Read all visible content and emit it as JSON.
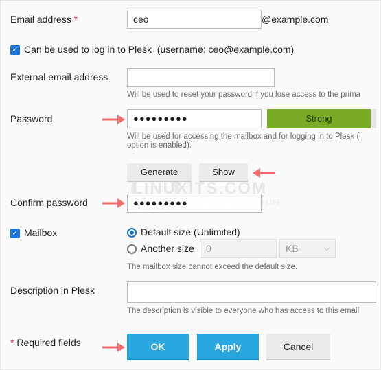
{
  "email": {
    "label": "Email address",
    "required_mark": "*",
    "value": "ceo",
    "domain": "@example.com"
  },
  "login": {
    "label": "Can be used to log in to Plesk",
    "username": "(username: ceo@example.com)",
    "checked": true
  },
  "external": {
    "label": "External email address",
    "value": "",
    "hint": "Will be used to reset your password if you lose access to the prima"
  },
  "password": {
    "label": "Password",
    "value": "●●●●●●●●●",
    "strength": "Strong",
    "strength_color": "#7aab27",
    "hint1": "Will be used for accessing the mailbox and for logging in to Plesk (i",
    "hint2": "option is enabled).",
    "generate": "Generate",
    "show": "Show"
  },
  "confirm": {
    "label": "Confirm password",
    "value": "●●●●●●●●●"
  },
  "mailbox": {
    "label": "Mailbox",
    "checked": true,
    "default_size": "Default size (Unlimited)",
    "another_size": "Another size",
    "size_value": "0",
    "unit": "KB",
    "hint": "The mailbox size cannot exceed the default size."
  },
  "description": {
    "label": "Description in Plesk",
    "value": "",
    "hint": "The description is visible to everyone who has access to this email"
  },
  "footer": {
    "required_mark": "*",
    "required_text": "Required fields",
    "ok": "OK",
    "apply": "Apply",
    "cancel": "Cancel"
  },
  "watermark": {
    "brand": "LINUXITS.COM",
    "tagline": "MAKE EASY YOUR SYSADMIN LIFE"
  },
  "colors": {
    "primary": "#28a8de",
    "arrow": "#f26b6b",
    "checkbox": "#1a73d9"
  }
}
